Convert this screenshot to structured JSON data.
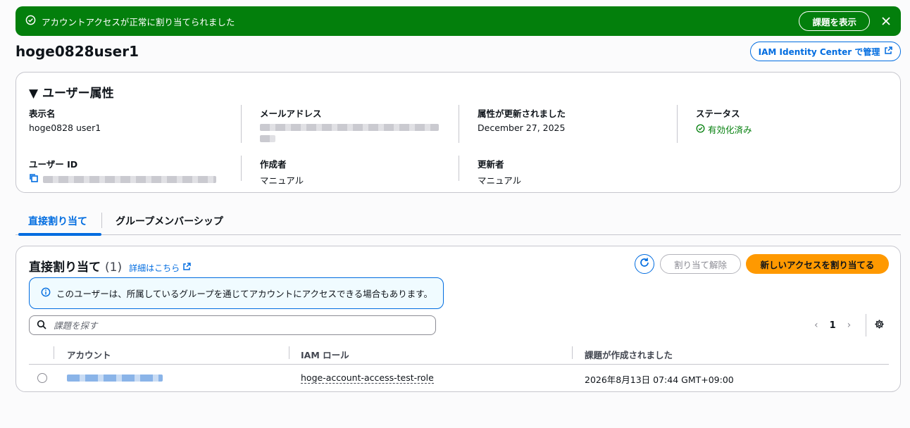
{
  "flash": {
    "message": "アカウントアクセスが正常に割り当てられました",
    "view_issue_label": "課題を表示",
    "color": "#037f0c"
  },
  "header": {
    "title": "hoge0828user1",
    "iam_button_label": "IAM Identity Center で管理"
  },
  "attributes": {
    "section_title": "ユーザー属性",
    "display_name": {
      "label": "表示名",
      "value": "hoge0828 user1"
    },
    "email": {
      "label": "メールアドレス"
    },
    "updated": {
      "label": "属性が更新されました",
      "value": "December 27, 2025"
    },
    "status": {
      "label": "ステータス",
      "value": "有効化済み"
    },
    "user_id": {
      "label": "ユーザー ID"
    },
    "created_by": {
      "label": "作成者",
      "value": "マニュアル"
    },
    "updated_by": {
      "label": "更新者",
      "value": "マニュアル"
    }
  },
  "tabs": [
    {
      "label": "直接割り当て",
      "active": true
    },
    {
      "label": "グループメンバーシップ",
      "active": false
    }
  ],
  "assignments": {
    "title": "直接割り当て",
    "count": "(1)",
    "learn_more": "詳細はこちら",
    "unassign_label": "割り当て解除",
    "assign_label": "新しいアクセスを割り当てる",
    "info_text": "このユーザーは、所属しているグループを通じてアカウントにアクセスできる場合もあります。",
    "search_placeholder": "課題を探す",
    "page": "1",
    "columns": [
      "アカウント",
      "IAM ロール",
      "課題が作成されました"
    ],
    "rows": [
      {
        "role": "hoge-account-access-test-role",
        "created": "2026年8月13日 07:44 GMT+09:00"
      }
    ]
  },
  "colors": {
    "accent": "#006ce0",
    "primary": "#ff9900",
    "success": "#037f0c"
  }
}
